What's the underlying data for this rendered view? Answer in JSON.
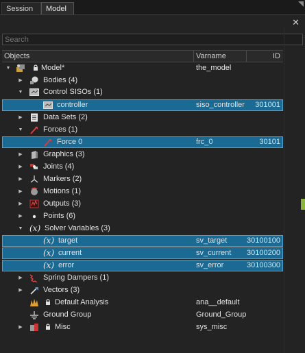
{
  "tabs": {
    "session": "Session",
    "model": "Model"
  },
  "close_glyph": "✕",
  "search": {
    "placeholder": "Search"
  },
  "columns": {
    "objects": "Objects",
    "varname": "Varname",
    "id": "ID"
  },
  "tree": {
    "model": {
      "label": "Model*",
      "varname": "the_model"
    },
    "bodies": "Bodies (4)",
    "control_sisos": "Control SISOs (1)",
    "controller": {
      "label": "controller",
      "varname": "siso_controller",
      "id": "301001"
    },
    "data_sets": "Data Sets (2)",
    "forces": "Forces (1)",
    "force0": {
      "label": "Force 0",
      "varname": "frc_0",
      "id": "30101"
    },
    "graphics": "Graphics (3)",
    "joints": "Joints (4)",
    "markers": "Markers (2)",
    "motions": "Motions (1)",
    "outputs": "Outputs (3)",
    "points": "Points (6)",
    "solver_variables": "Solver Variables (3)",
    "sv_glyph": "(x)",
    "target": {
      "label": "target",
      "varname": "sv_target",
      "id": "30100100"
    },
    "current": {
      "label": "current",
      "varname": "sv_current",
      "id": "30100200"
    },
    "error": {
      "label": "error",
      "varname": "sv_error",
      "id": "30100300"
    },
    "spring_dampers": "Spring Dampers (1)",
    "vectors": "Vectors (3)",
    "default_analysis": {
      "label": "Default Analysis",
      "varname": "ana__default"
    },
    "ground_group": {
      "label": "Ground Group",
      "varname": "Ground_Group"
    },
    "misc": {
      "label": "Misc",
      "varname": "sys_misc"
    }
  },
  "colors": {
    "selection": "#1b6a93",
    "background": "#232323",
    "accent_green": "#8ab43c"
  },
  "icons": [
    "model-icon",
    "bodies-icon",
    "control-siso-icon",
    "data-sets-icon",
    "forces-icon",
    "graphics-icon",
    "joints-icon",
    "markers-icon",
    "motions-icon",
    "outputs-icon",
    "points-icon",
    "solver-variable-icon",
    "spring-dampers-icon",
    "vectors-icon",
    "analysis-icon",
    "ground-icon",
    "misc-icon",
    "lock-icon"
  ]
}
